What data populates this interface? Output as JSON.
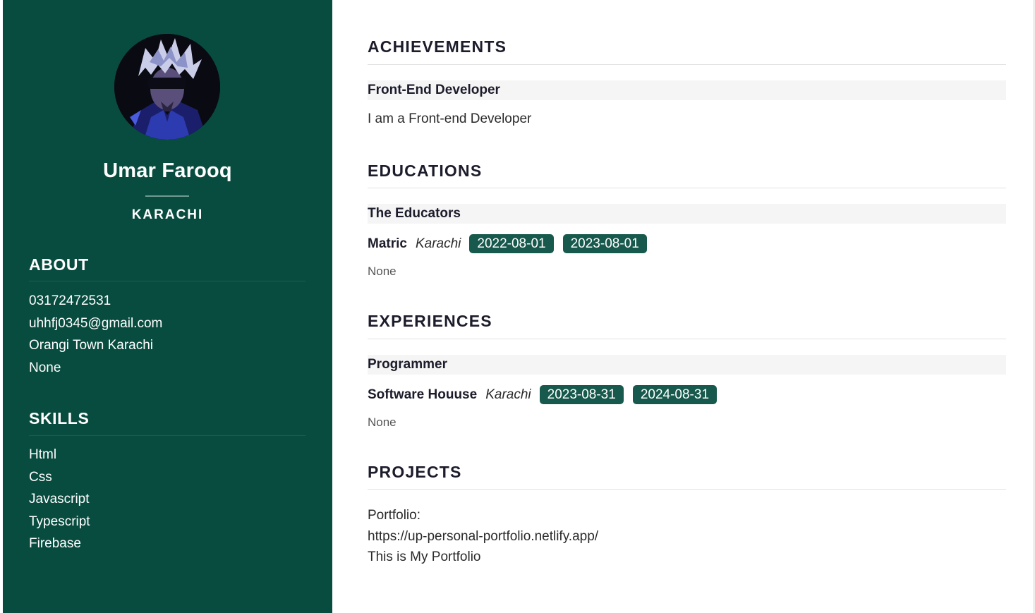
{
  "profile": {
    "name": "Umar Farooq",
    "city": "KARACHI",
    "avatar_icon": "anime-character-avatar"
  },
  "about": {
    "heading": "ABOUT",
    "items": [
      "03172472531",
      "uhhfj0345@gmail.com",
      "Orangi Town Karachi",
      "None"
    ]
  },
  "skills": {
    "heading": "SKILLS",
    "items": [
      "Html",
      "Css",
      "Javascript",
      "Typescript",
      "Firebase"
    ]
  },
  "achievements": {
    "heading": "ACHIEVEMENTS",
    "title": "Front-End Developer",
    "description": "I am a Front-end Developer"
  },
  "educations": {
    "heading": "EDUCATIONS",
    "title": "The Educators",
    "degree": "Matric",
    "location": "Karachi",
    "start": "2022-08-01",
    "end": "2023-08-01",
    "description": "None"
  },
  "experiences": {
    "heading": "EXPERIENCES",
    "title": "Programmer",
    "company": "Software Houuse",
    "location": "Karachi",
    "start": "2023-08-31",
    "end": "2024-08-31",
    "description": "None"
  },
  "projects": {
    "heading": "PROJECTS",
    "name": "Portfolio:",
    "url": "https://up-personal-portfolio.netlify.app/",
    "description": "This is My Portfolio"
  },
  "colors": {
    "sidebar_bg": "#084c40",
    "badge_bg": "#17594c",
    "heading_text": "#1c1c2b"
  }
}
